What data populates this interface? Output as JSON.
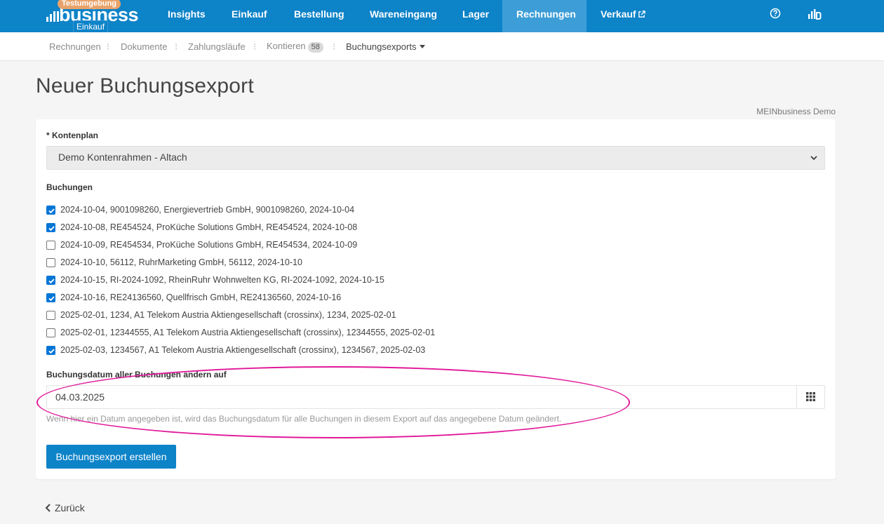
{
  "brand": {
    "badge": "Testumgebung",
    "word": "business",
    "sub": "Einkauf"
  },
  "nav": {
    "items": [
      "Insights",
      "Einkauf",
      "Bestellung",
      "Wareneingang",
      "Lager",
      "Rechnungen",
      "Verkauf"
    ],
    "active": "Rechnungen"
  },
  "subnav": {
    "items": [
      "Rechnungen",
      "Dokumente",
      "Zahlungsläufe",
      "Kontieren",
      "Buchungsexports"
    ],
    "kontieren_count": "58"
  },
  "page": {
    "title": "Neuer Buchungsexport",
    "tenant": "MEINbusiness Demo"
  },
  "form": {
    "kontenplan_label": "* Kontenplan",
    "kontenplan_value": "Demo Kontenrahmen - Altach",
    "buchungen_label": "Buchungen",
    "buchungen": [
      {
        "label": "2024-10-04, 9001098260, Energievertrieb GmbH, 9001098260, 2024-10-04",
        "checked": true
      },
      {
        "label": "2024-10-08, RE454524, ProKüche Solutions GmbH, RE454524, 2024-10-08",
        "checked": true
      },
      {
        "label": "2024-10-09, RE454534, ProKüche Solutions GmbH, RE454534, 2024-10-09",
        "checked": false
      },
      {
        "label": "2024-10-10, 56112, RuhrMarketing GmbH, 56112, 2024-10-10",
        "checked": false
      },
      {
        "label": "2024-10-15, RI-2024-1092, RheinRuhr Wohnwelten KG, RI-2024-1092, 2024-10-15",
        "checked": true
      },
      {
        "label": "2024-10-16, RE24136560, Quellfrisch GmbH, RE24136560, 2024-10-16",
        "checked": true
      },
      {
        "label": "2025-02-01, 1234, A1 Telekom Austria Aktiengesellschaft (crossinx), 1234, 2025-02-01",
        "checked": false
      },
      {
        "label": "2025-02-01, 12344555, A1 Telekom Austria Aktiengesellschaft (crossinx), 12344555, 2025-02-01",
        "checked": false
      },
      {
        "label": "2025-02-03, 1234567, A1 Telekom Austria Aktiengesellschaft (crossinx), 1234567, 2025-02-03",
        "checked": true
      }
    ],
    "datum_label": "Buchungsdatum aller Buchungen ändern auf",
    "datum_value": "04.03.2025",
    "datum_help": "Wenn hier ein Datum angegeben ist, wird das Buchungsdatum für alle Buchungen in diesem Export auf das angegebene Datum geändert.",
    "submit_label": "Buchungsexport erstellen"
  },
  "footer": {
    "back_label": "Zurück"
  },
  "colors": {
    "primary": "#0d83c8",
    "active_nav": "#3d9ed7",
    "highlight": "#e0189a",
    "badge_orange": "#e8a36a"
  }
}
